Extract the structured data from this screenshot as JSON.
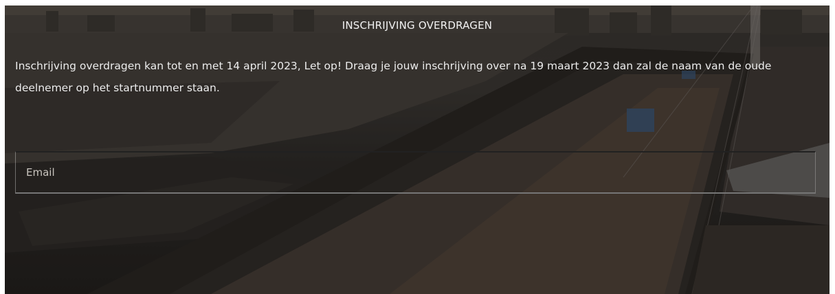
{
  "form": {
    "title": "INSCHRIJVING OVERDRAGEN",
    "notice": "Inschrijving overdragen kan tot en met 14 april 2023, Let op! Draag je jouw inschrijving over na 19 maart  2023 dan zal de naam van de oude deelnemer op het startnummer staan.",
    "email_placeholder": "Email",
    "email_value": ""
  },
  "colors": {
    "text": "#ececec",
    "overlay": "#141210"
  }
}
